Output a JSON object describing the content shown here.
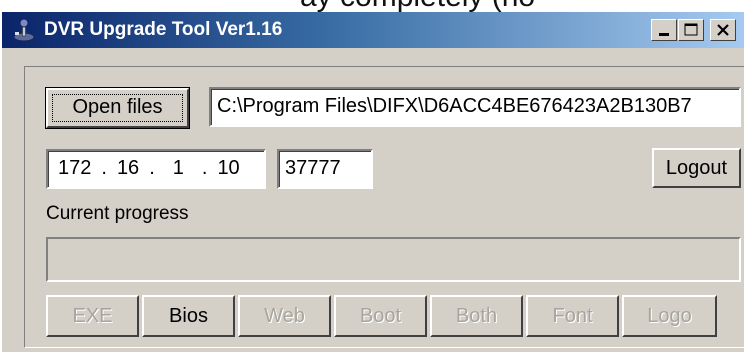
{
  "topstrip": {
    "text": "ay completely (no"
  },
  "window": {
    "title": "DVR Upgrade Tool Ver1.16",
    "icons": {
      "app": "joystick-icon",
      "minimize": "minimize-icon",
      "maximize": "maximize-icon",
      "close": "close-icon"
    }
  },
  "file": {
    "open_button": "Open files",
    "path_value": "C:\\Program Files\\DIFX\\D6ACC4BE676423A2B130B7"
  },
  "connection": {
    "ip": [
      "172",
      "16",
      "1",
      "10"
    ],
    "port": "37777",
    "logout_button": "Logout"
  },
  "progress": {
    "label": "Current progress",
    "value": 0
  },
  "upgrade_buttons": [
    {
      "label": "EXE",
      "enabled": false
    },
    {
      "label": "Bios",
      "enabled": true
    },
    {
      "label": "Web",
      "enabled": false
    },
    {
      "label": "Boot",
      "enabled": false
    },
    {
      "label": "Both",
      "enabled": false
    },
    {
      "label": "Font",
      "enabled": false
    },
    {
      "label": "Logo",
      "enabled": false
    }
  ]
}
